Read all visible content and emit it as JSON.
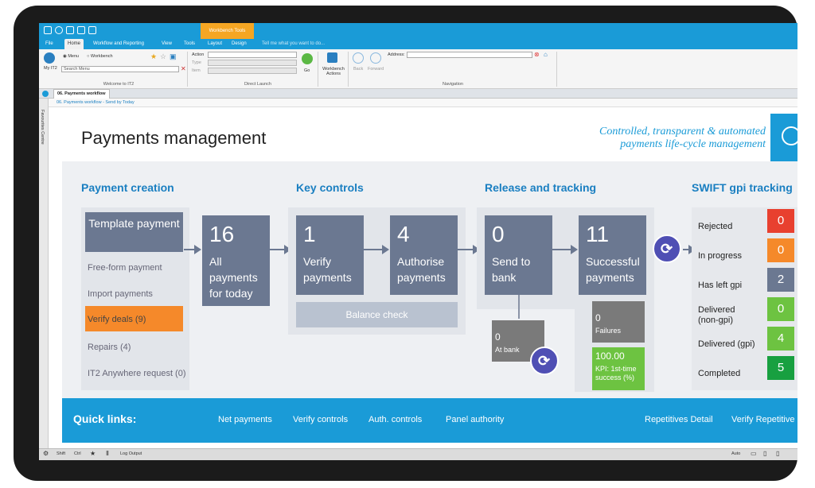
{
  "titlebar": {
    "tool_tab": "Workbench Tools"
  },
  "menu": {
    "tabs": [
      "File",
      "Home",
      "Workflow and Reporting",
      "View",
      "Tools",
      "Layout",
      "Design"
    ],
    "active": "Home",
    "tellme": "Tell me what you want to do..."
  },
  "ribbon": {
    "my_it2": "My IT2",
    "radio_menu": "Menu",
    "radio_workbench": "Workbench",
    "search_placeholder": "Search Menu",
    "group_welcome": "Welcome to IT2",
    "action_label": "Action",
    "type_label": "Type",
    "item_label": "Item",
    "go_label": "Go",
    "group_direct": "Direct Launch",
    "wb_actions": "Workbench Actions",
    "back": "Back",
    "forward": "Forward",
    "address_label": "Address:",
    "group_nav": "Navigation"
  },
  "doc_tab": "06. Payments workflow",
  "sidebar_label": "Favourites Centre",
  "breadcrumb": "06. Payments workflow - Send by Today",
  "page": {
    "title": "Payments management",
    "tagline_1": "Controlled, transparent & automated",
    "tagline_2": "payments life-cycle management"
  },
  "sections": {
    "creation": "Payment creation",
    "controls": "Key controls",
    "release": "Release and tracking",
    "gpi": "SWIFT gpi tracking"
  },
  "creation": {
    "template": "Template payment",
    "items": [
      "Free-form payment",
      "Import payments",
      "Verify deals (9)",
      "Repairs (4)",
      "IT2 Anywhere request (0)"
    ]
  },
  "boxes": {
    "all": {
      "num": "16",
      "label": "All payments for today"
    },
    "verify": {
      "num": "1",
      "label": "Verify payments"
    },
    "authorise": {
      "num": "4",
      "label": "Authorise payments"
    },
    "send": {
      "num": "0",
      "label": "Send to bank"
    },
    "success": {
      "num": "11",
      "label": "Successful payments"
    },
    "balance": "Balance check",
    "at_bank": {
      "num": "0",
      "label": "At bank"
    },
    "failures": {
      "num": "0",
      "label": "Failures"
    },
    "kpi": {
      "num": "100.00",
      "label": "KPI: 1st-time success (%)"
    }
  },
  "gpi": [
    {
      "label": "Rejected",
      "value": "0",
      "color": "#e8402f"
    },
    {
      "label": "In progress",
      "value": "0",
      "color": "#f5892a"
    },
    {
      "label": "Has left gpi",
      "value": "2",
      "color": "#6b7891"
    },
    {
      "label": "Delivered (non-gpi)",
      "value": "0",
      "color": "#6dc341"
    },
    {
      "label": "Delivered (gpi)",
      "value": "4",
      "color": "#6dc341"
    },
    {
      "label": "Completed",
      "value": "5",
      "color": "#18a040"
    }
  ],
  "quick": {
    "title": "Quick links:",
    "links": [
      "Net payments",
      "Verify controls",
      "Auth. controls",
      "Panel authority",
      "Repetitives Detail",
      "Verify Repetitive"
    ]
  },
  "status": {
    "shift": "Shift",
    "ctrl": "Ctrl",
    "log": "Log Output",
    "auto": "Auto"
  },
  "colors": {
    "accent": "#1a9bd7",
    "box": "#6b7891",
    "orange": "#f5892a",
    "green": "#6dc341"
  }
}
